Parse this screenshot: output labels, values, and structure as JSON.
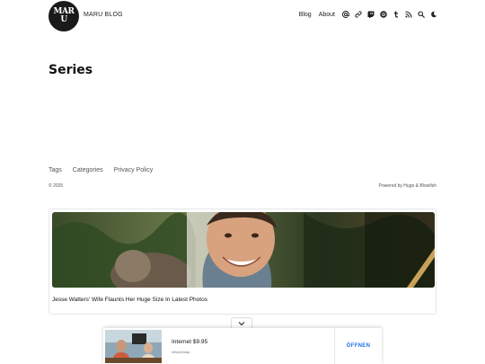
{
  "header": {
    "logo_text": "MARU",
    "site_title": "MARU BLOG",
    "nav": {
      "blog": "Blog",
      "about": "About"
    },
    "icons": [
      "at-icon",
      "link-icon",
      "twitch-icon",
      "spotify-icon",
      "tumblr-icon",
      "rss-icon",
      "search-icon",
      "dark-mode-icon"
    ]
  },
  "main": {
    "title": "Series"
  },
  "footer": {
    "links": [
      "Tags",
      "Categories",
      "Privacy Policy"
    ],
    "copyright": "© 2025",
    "powered_by": "Powered by Hugo & Blowfish"
  },
  "ad": {
    "headline": "Jesse Watters' Wife Flaunts Her Huge Size In Latest Photos"
  },
  "bottom_ad": {
    "title": "Internet $9.95",
    "subtitle": "infopicheap",
    "cta": "ÖFFNEN",
    "accent": "#1a73e8"
  }
}
